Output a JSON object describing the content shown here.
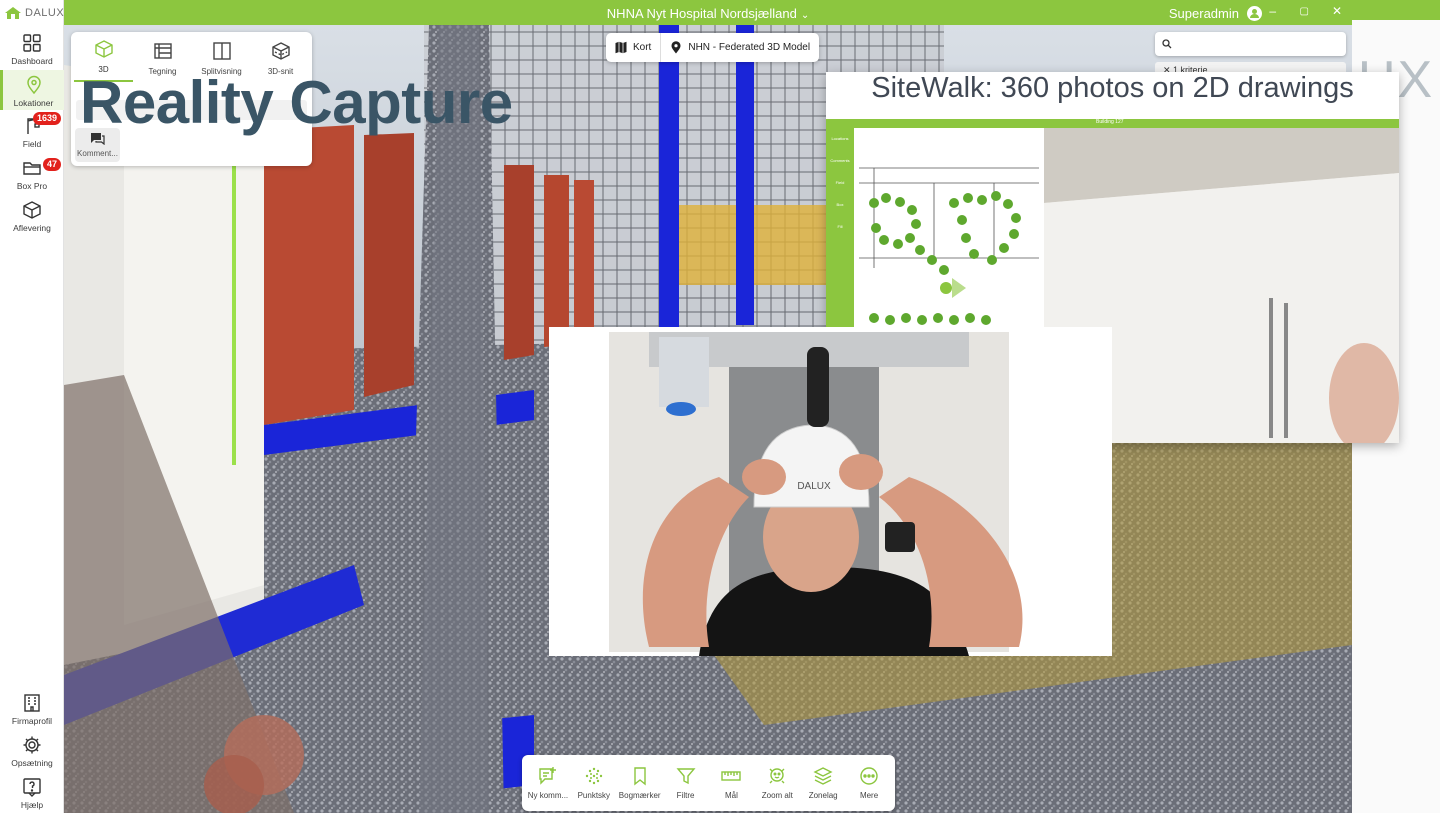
{
  "app": {
    "logo_text": "DALUX",
    "project_title": "NHNA Nyt Hospital Nordsjælland",
    "user_name": "Superadmin",
    "window_controls": {
      "minimize": "–",
      "maximize": "▢",
      "close": "✕"
    }
  },
  "sidebar": {
    "top_items": [
      {
        "label": "Dashboard",
        "icon": "grid-icon",
        "active": false
      },
      {
        "label": "Lokationer",
        "icon": "location-pin-icon",
        "active": true
      },
      {
        "label": "Field",
        "icon": "crane-icon",
        "badge": "1639"
      },
      {
        "label": "Box Pro",
        "icon": "folder-icon",
        "badge": "47"
      },
      {
        "label": "Aflevering",
        "icon": "box-icon"
      }
    ],
    "bottom_items": [
      {
        "label": "Firmaprofil",
        "icon": "building-icon"
      },
      {
        "label": "Opsætning",
        "icon": "gear-icon"
      },
      {
        "label": "Hjælp",
        "icon": "help-icon"
      }
    ]
  },
  "view_modes": {
    "items": [
      {
        "label": "3D",
        "icon": "cube-icon",
        "active": true
      },
      {
        "label": "Tegning",
        "icon": "drawing-icon"
      },
      {
        "label": "Splitvisning",
        "icon": "split-view-icon"
      },
      {
        "label": "3D-snit",
        "icon": "section-cube-icon"
      }
    ],
    "comments_label": "Komment..."
  },
  "overlay_heading": "Reality Capture",
  "model_selector": {
    "map_label": "Kort",
    "model_label": "NHN - Federated 3D Model"
  },
  "filter": {
    "criteria_label": "1 kriterie"
  },
  "sitewalk": {
    "title": "SiteWalk: 360 photos on 2D drawings",
    "inner_topbar": "Building 127",
    "inner_sidebar": [
      "Locations",
      "Comments",
      "Field",
      "Box",
      "Fill"
    ]
  },
  "helmet_text": "DALUX",
  "bottom_toolbar": [
    {
      "label": "Ny komm...",
      "icon": "new-comment-icon"
    },
    {
      "label": "Punktsky",
      "icon": "point-cloud-icon"
    },
    {
      "label": "Bogmærker",
      "icon": "bookmark-icon"
    },
    {
      "label": "Filtre",
      "icon": "filter-icon"
    },
    {
      "label": "Mål",
      "icon": "ruler-icon"
    },
    {
      "label": "Zoom alt",
      "icon": "zoom-all-icon"
    },
    {
      "label": "Zonelag",
      "icon": "layers-icon"
    },
    {
      "label": "Mere",
      "icon": "more-icon"
    }
  ],
  "colors": {
    "brand_green": "#8cc63f",
    "badge_red": "#e2211c",
    "heading_slate": "#3a5566"
  }
}
